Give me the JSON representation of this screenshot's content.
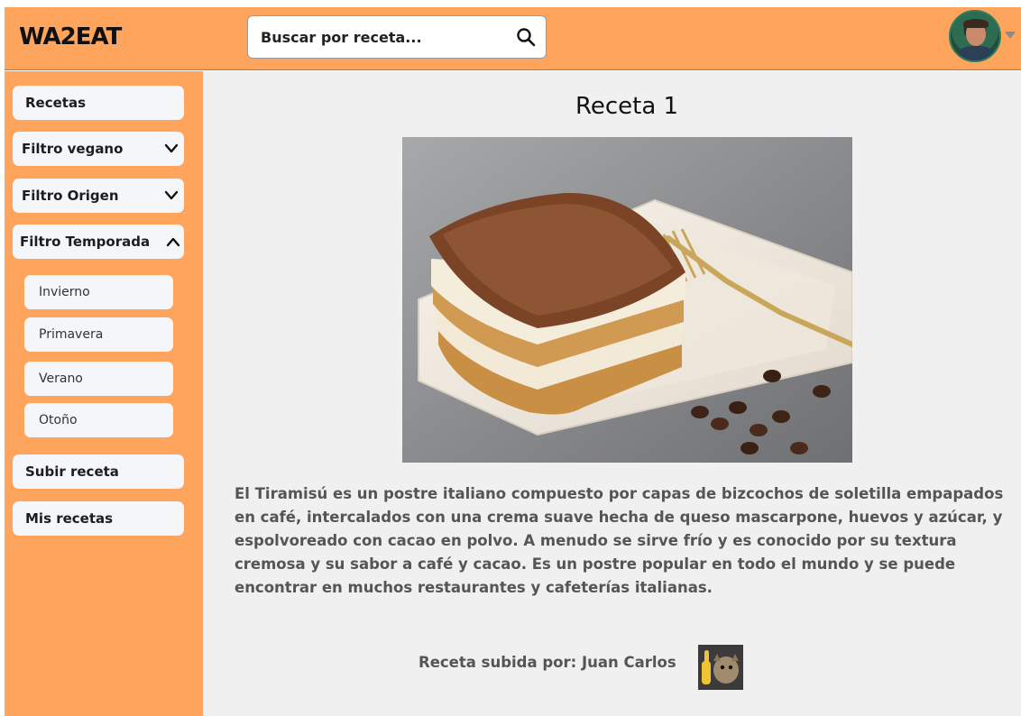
{
  "app": {
    "logo_text": "WA2EAT"
  },
  "search": {
    "placeholder": "Buscar por receta..."
  },
  "sidebar": {
    "recetas": "Recetas",
    "filtro_vegano": "Filtro vegano",
    "filtro_origen": "Filtro Origen",
    "filtro_temporada": "Filtro Temporada",
    "temporadas": [
      "Invierno",
      "Primavera",
      "Verano",
      "Otoño"
    ],
    "subir_receta": "Subir receta",
    "mis_recetas": "Mis recetas"
  },
  "recipe": {
    "title": "Receta 1",
    "description": "El Tiramisú es un postre italiano compuesto por capas de bizcochos de soletilla empapados en café, intercalados con una crema suave hecha de queso mascarpone, huevos y azúcar, y espolvoreado con cacao en polvo. A menudo se sirve frío y es conocido por su textura cremosa y su sabor a café y cacao. Es un postre popular en todo el mundo y se puede encontrar en muchos restaurantes y cafeterías italianas.",
    "author_label": "Receta subida por: Juan Carlos"
  },
  "icons": {
    "search": "search-icon",
    "chevron_down": "chevron-down-icon",
    "chevron_up": "chevron-up-icon",
    "caret": "caret-down-icon"
  },
  "colors": {
    "accent": "#ffa45c",
    "main_bg": "#f0f0f0",
    "button_bg": "#f4f6fa"
  }
}
